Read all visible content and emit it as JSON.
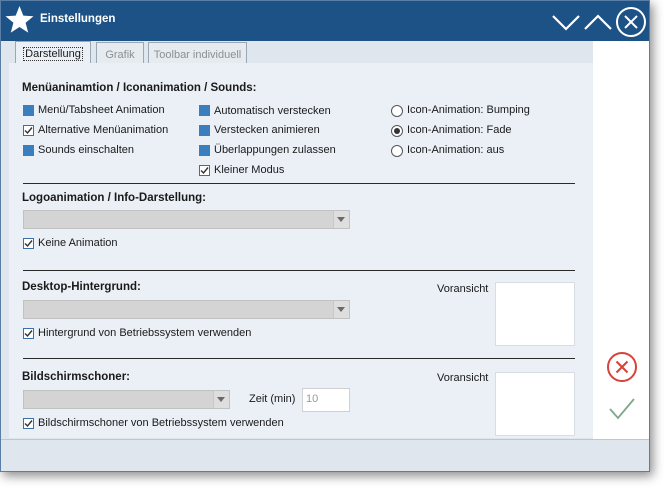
{
  "window": {
    "title": "Einstellungen",
    "icons": {
      "app": "star-icon",
      "minimize": "chevron-down-icon",
      "maximize": "chevron-up-icon",
      "close": "close-circle-icon"
    }
  },
  "tabs": [
    {
      "label": "Darstellung",
      "active": true
    },
    {
      "label": "Grafik",
      "active": false
    },
    {
      "label": "Toolbar individuell",
      "active": false
    }
  ],
  "menu_section": {
    "title": "Menüaninamtion / Iconanimation / Sounds:",
    "col1": [
      {
        "label": "Menü/Tabsheet Animation",
        "state": "indeterminate"
      },
      {
        "label": "Alternative Menüanimation",
        "state": "checked"
      },
      {
        "label": "Sounds einschalten",
        "state": "indeterminate"
      }
    ],
    "col2": [
      {
        "label": "Automatisch verstecken",
        "state": "indeterminate"
      },
      {
        "label": "Verstecken animieren",
        "state": "indeterminate"
      },
      {
        "label": "Überlappungen zulassen",
        "state": "indeterminate"
      },
      {
        "label": "Kleiner Modus",
        "state": "checked"
      }
    ],
    "radios": [
      {
        "label": "Icon-Animation: Bumping",
        "selected": false
      },
      {
        "label": "Icon-Animation: Fade",
        "selected": true
      },
      {
        "label": "Icon-Animation: aus",
        "selected": false
      }
    ]
  },
  "logo_section": {
    "title": "Logoanimation / Info-Darstellung:",
    "combo_value": "",
    "checkbox": {
      "label": "Keine Animation",
      "state": "checked"
    }
  },
  "desktop_section": {
    "title": "Desktop-Hintergrund:",
    "combo_value": "",
    "preview_label": "Voransicht",
    "checkbox": {
      "label": "Hintergrund von Betriebssystem verwenden",
      "state": "checked"
    }
  },
  "screensaver_section": {
    "title": "Bildschirmschoner:",
    "combo_value": "",
    "time_label": "Zeit (min)",
    "time_value": "10",
    "preview_label": "Voransicht",
    "checkbox": {
      "label": "Bildschirmschoner von Betriebssystem verwenden",
      "state": "checked"
    }
  },
  "actions": {
    "cancel_icon": "cancel-circle-icon",
    "ok_icon": "checkmark-icon",
    "colors": {
      "cancel": "#d9423a",
      "ok": "#7ea88a",
      "titlebar": "#1d5286",
      "accent": "#3b7ebd"
    }
  }
}
